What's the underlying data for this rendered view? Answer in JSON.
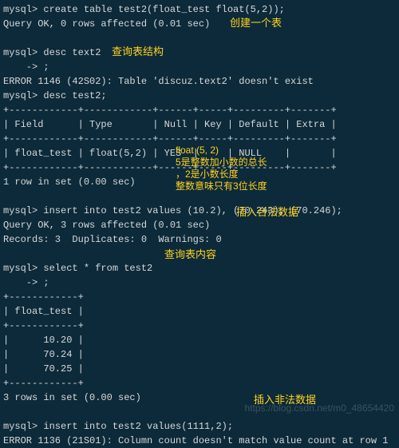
{
  "terminal": {
    "l01": "mysql> create table test2(float_test float(5,2));",
    "l02": "Query OK, 0 rows affected (0.01 sec)",
    "l03": "",
    "l04": "mysql> desc text2",
    "l05": "    -> ;",
    "l06": "ERROR 1146 (42S02): Table 'discuz.text2' doesn't exist",
    "l07": "mysql> desc test2;",
    "l08": "+------------+------------+------+-----+---------+-------+",
    "l09": "| Field      | Type       | Null | Key | Default | Extra |",
    "l10": "+------------+------------+------+-----+---------+-------+",
    "l11": "| float_test | float(5,2) | YES  |     | NULL    |       |",
    "l12": "+------------+------------+------+-----+---------+-------+",
    "l13": "1 row in set (0.00 sec)",
    "l14": "",
    "l15": "mysql> insert into test2 values (10.2), (70.243), (70.246);",
    "l16": "Query OK, 3 rows affected (0.01 sec)",
    "l17": "Records: 3  Duplicates: 0  Warnings: 0",
    "l18": "",
    "l19": "mysql> select * from test2",
    "l20": "    -> ;",
    "l21": "+------------+",
    "l22": "| float_test |",
    "l23": "+------------+",
    "l24": "|      10.20 |",
    "l25": "|      70.24 |",
    "l26": "|      70.25 |",
    "l27": "+------------+",
    "l28": "3 rows in set (0.00 sec)",
    "l29": "",
    "l30": "mysql> insert into test2 values(1111,2);",
    "l31": "ERROR 1136 (21S01): Column count doesn't match value count at row 1"
  },
  "annotations": {
    "a1": "创建一个表",
    "a2": "查询表结构",
    "a3": "float (5, 2)",
    "a4": "5是整数加小数的总长",
    "a5": "，2是小数长度",
    "a6": "整数意味只有3位长度",
    "a7": "插入合法数据",
    "a8": "查询表内容",
    "a9": "插入非法数据"
  },
  "watermark": "https://blog.csdn.net/m0_48654420",
  "chart_data": {
    "type": "table",
    "describe_columns": [
      "Field",
      "Type",
      "Null",
      "Key",
      "Default",
      "Extra"
    ],
    "describe_rows": [
      [
        "float_test",
        "float(5,2)",
        "YES",
        "",
        "NULL",
        ""
      ]
    ],
    "select_columns": [
      "float_test"
    ],
    "select_rows": [
      [
        10.2
      ],
      [
        70.24
      ],
      [
        70.25
      ]
    ]
  }
}
